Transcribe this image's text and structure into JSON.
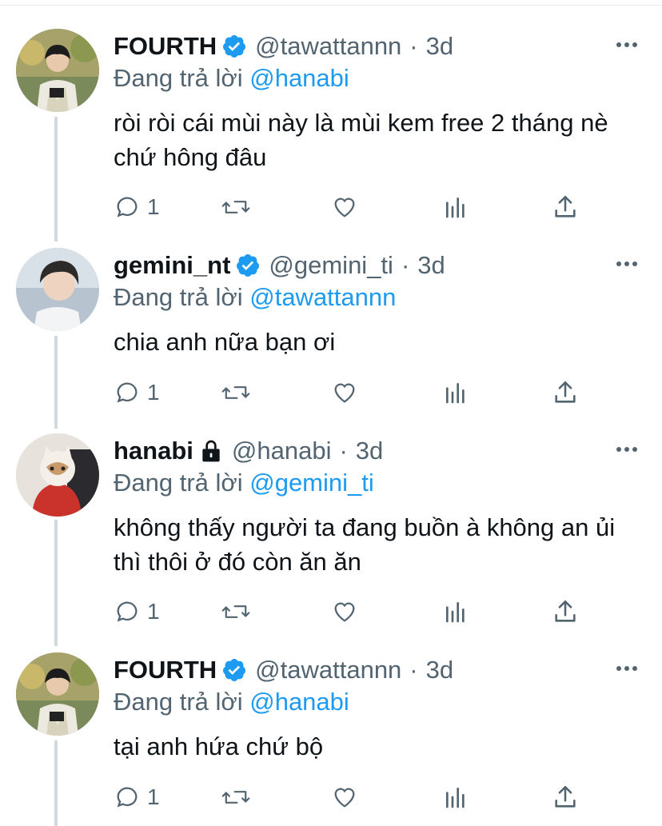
{
  "tweets": [
    {
      "display_name": "FOURTH",
      "badge": "verified-badge-icon",
      "handle": "@tawattannn",
      "separator": "·",
      "time": "3d",
      "reply_prefix": "Đang trả lời ",
      "reply_mention": "@hanabi",
      "text": "ròi ròi cái mùi này là mùi kem free 2 tháng nè chứ hông đâu",
      "reply_count": "1"
    },
    {
      "display_name": "gemini_nt",
      "badge": "verified-badge-icon",
      "handle": "@gemini_ti",
      "separator": "·",
      "time": "3d",
      "reply_prefix": "Đang trả lời ",
      "reply_mention": "@tawattannn",
      "text": "chia anh nữa bạn ơi",
      "reply_count": "1"
    },
    {
      "display_name": "hanabi",
      "badge": "lock-icon",
      "handle": "@hanabi",
      "separator": "·",
      "time": "3d",
      "reply_prefix": "Đang trả lời ",
      "reply_mention": "@gemini_ti",
      "text": "không thấy người ta đang buồn à không an ủi thì thôi ở đó còn ăn ăn",
      "reply_count": "1"
    },
    {
      "display_name": "FOURTH",
      "badge": "verified-badge-icon",
      "handle": "@tawattannn",
      "separator": "·",
      "time": "3d",
      "reply_prefix": "Đang trả lời ",
      "reply_mention": "@hanabi",
      "text": "tại anh hứa chứ bộ",
      "reply_count": "1"
    }
  ],
  "colors": {
    "accent": "#1d9bf0",
    "secondary_text": "#536471",
    "primary_text": "#0f1419",
    "thread_line": "#cfd9de"
  },
  "icons": {
    "reply": "reply-icon",
    "retweet": "retweet-icon",
    "like": "heart-icon",
    "analytics": "analytics-icon",
    "share": "share-icon",
    "more": "more-icon"
  }
}
